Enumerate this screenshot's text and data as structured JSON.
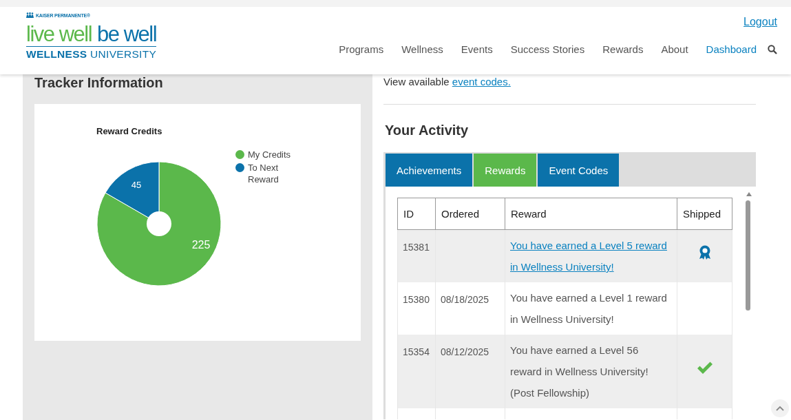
{
  "header": {
    "brand": "KAISER PERMANENTE®",
    "logo_part_1": "live **well**",
    "logo_part_2": "be **well**",
    "logo_subtitle": "**WELLNESS** UNIVERSITY",
    "logout": "Logout",
    "nav": [
      {
        "label": "Programs",
        "selected": false
      },
      {
        "label": "Wellness",
        "selected": false
      },
      {
        "label": "Events",
        "selected": false
      },
      {
        "label": "Success Stories",
        "selected": false
      },
      {
        "label": "Rewards",
        "selected": false
      },
      {
        "label": "About",
        "selected": false
      },
      {
        "label": "Dashboard",
        "selected": true
      }
    ]
  },
  "tracker": {
    "title": "Tracker Information",
    "chart_data": {
      "type": "pie",
      "legend": "right",
      "title": "Reward Credits",
      "categories": [
        "My Credits",
        "To Next Reward"
      ],
      "values": [
        225,
        45
      ],
      "colors": [
        "#5bb84b",
        "#0b72aa"
      ],
      "data_labels": true
    }
  },
  "activity": {
    "intro": "View available",
    "intro_link": "event codes.",
    "title": "Your Activity",
    "tabs": [
      {
        "label": "Achievements",
        "selected": false
      },
      {
        "label": "Rewards",
        "selected": true
      },
      {
        "label": "Event Codes",
        "selected": false
      }
    ],
    "table": {
      "columns": [
        "ID",
        "Ordered",
        "Reward",
        "Shipped"
      ],
      "rows": [
        {
          "id": "15381",
          "ordered": "",
          "reward": "You have earned a Level 5 reward in Wellness University!",
          "reward_link": true,
          "kind": "ribbon"
        },
        {
          "id": "15380",
          "ordered": "08/18/2025",
          "reward": "You have earned a Level 1 reward in Wellness University!",
          "reward_link": false,
          "kind": "none"
        },
        {
          "id": "15354",
          "ordered": "08/12/2025",
          "reward": "You have earned a Level 56 reward in Wellness University! (Post Fellowship)",
          "reward_link": false,
          "kind": "check"
        }
      ]
    }
  }
}
